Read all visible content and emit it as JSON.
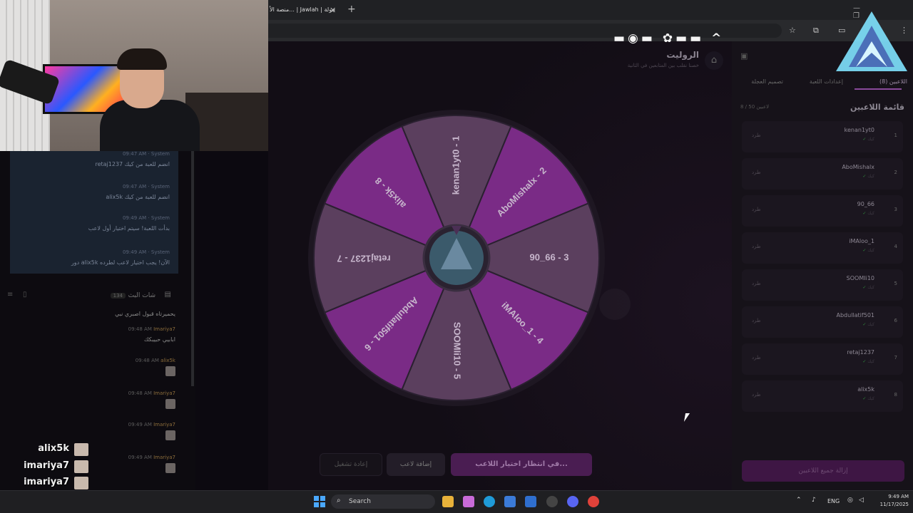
{
  "browser": {
    "tab_title": "منصة الأ... | Jawlah | جولة",
    "tab_close": "✕",
    "new_tab": "+",
    "window_controls": "— ❐ ✕"
  },
  "page": {
    "title": "الروليت",
    "subtitle": "خصنا نقلب بين المتابعين في الثانية"
  },
  "wheel": {
    "segments": [
      {
        "label": "kenan1yt0 - 1",
        "color": "#5b3f5e"
      },
      {
        "label": "AboMishalx - 2",
        "color": "#7a2b86"
      },
      {
        "label": "90_66 - 3",
        "color": "#5b3f5e"
      },
      {
        "label": "iMAloo_1 - 4",
        "color": "#7a2b86"
      },
      {
        "label": "SOOMIi10 - 5",
        "color": "#5b3f5e"
      },
      {
        "label": "Abdullatif501 - 6",
        "color": "#7a2b86"
      },
      {
        "label": "retaj1237 - 7",
        "color": "#5b3f5e"
      },
      {
        "label": "alix5k - 8",
        "color": "#7a2b86"
      }
    ]
  },
  "buttons": {
    "waiting": "في انتظار اختيار اللاعب...",
    "add_player": "إضافة لاعب",
    "restart": "إعادة تشغيل",
    "remove_all": "إزالة جميع اللاعبين"
  },
  "sidebar": {
    "tabs": [
      {
        "label": "اللاعبين (8)"
      },
      {
        "label": "إعدادات اللعبة"
      },
      {
        "label": "تصميم العجلة"
      }
    ],
    "list_title": "قائمة اللاعبين",
    "list_count": "8 / 50 لاعبين",
    "kick_label": "طرد",
    "players": [
      {
        "num": "1",
        "name": "kenan1yt0",
        "status": "كيك"
      },
      {
        "num": "2",
        "name": "AboMishalx",
        "status": "كيك"
      },
      {
        "num": "3",
        "name": "90_66",
        "status": "كيك"
      },
      {
        "num": "4",
        "name": "iMAloo_1",
        "status": "كيك"
      },
      {
        "num": "5",
        "name": "SOOMIi10",
        "status": "كيك"
      },
      {
        "num": "6",
        "name": "Abdullatif501",
        "status": "كيك"
      },
      {
        "num": "7",
        "name": "retaj1237",
        "status": "كيك"
      },
      {
        "num": "8",
        "name": "alix5k",
        "status": "كيك"
      }
    ]
  },
  "system_chat": [
    {
      "time": "09:47 AM",
      "sender": "System",
      "text": "retaj1237 انضم للعبة من كيك"
    },
    {
      "time": "09:47 AM",
      "sender": "System",
      "text": "alix5k انضم للعبة من كيك"
    },
    {
      "time": "09:49 AM",
      "sender": "System",
      "text": "بدأت اللعبة! سيتم اختيار أول لاعب"
    },
    {
      "time": "09:49 AM",
      "sender": "System",
      "text": "دور alix5k الآن! يجب اختيار لاعب لطرده"
    }
  ],
  "chat": {
    "title": "شات البث",
    "count": "134",
    "messages": [
      {
        "time": "",
        "user": "",
        "text": "يحميرتاه قبول اصبري نبي"
      },
      {
        "time": "09:48 AM",
        "user": "Imariya7",
        "text": "ابابيي حبيبكك"
      },
      {
        "time": "09:48 AM",
        "user": "alix5k",
        "text": ""
      },
      {
        "time": "09:48 AM",
        "user": "Imariya7",
        "text": ""
      },
      {
        "time": "09:49 AM",
        "user": "Imariya7",
        "text": ""
      },
      {
        "time": "09:49 AM",
        "user": "Imariya7",
        "text": ""
      }
    ]
  },
  "overlay_names": [
    "alix5k",
    "imariya7",
    "imariya7",
    "imariya7"
  ],
  "social_handle": "▬◉▬ ✿▬▬ ^",
  "taskbar": {
    "search_placeholder": "Search",
    "lang": "ENG",
    "time": "9:49 AM",
    "date": "11/17/2025"
  }
}
